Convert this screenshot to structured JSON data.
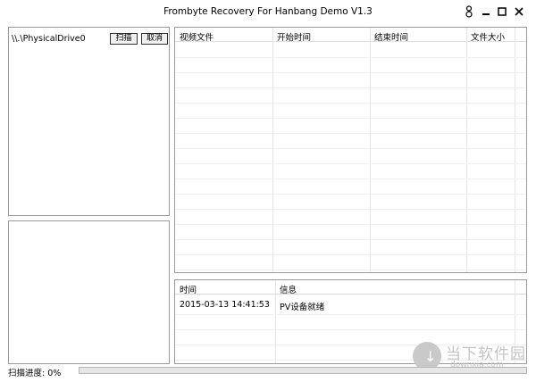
{
  "window": {
    "title": "Frombyte Recovery For Hanbang Demo V1.3",
    "controls": [
      "key",
      "minimize",
      "maximize",
      "close"
    ]
  },
  "drives": {
    "items": [
      "\\\\.\\PhysicalDrive0"
    ],
    "scan_label": "扫描",
    "cancel_label": "取消"
  },
  "video_table": {
    "columns": [
      "视频文件",
      "开始时间",
      "结束时间",
      "文件大小"
    ],
    "rows": []
  },
  "log_table": {
    "columns": [
      "时间",
      "信息"
    ],
    "rows": [
      {
        "time": "2015-03-13 14:41:53",
        "message": "PV设备就绪"
      }
    ]
  },
  "status": {
    "label": "扫描进度: 0%",
    "progress_fraction": 0
  },
  "watermark": {
    "cn": "当下软件园",
    "en": "downxia.com"
  },
  "colors": {
    "border": "#9a9a9a",
    "progress_fill": "#06b025",
    "watermark": "#c4c4c4"
  }
}
